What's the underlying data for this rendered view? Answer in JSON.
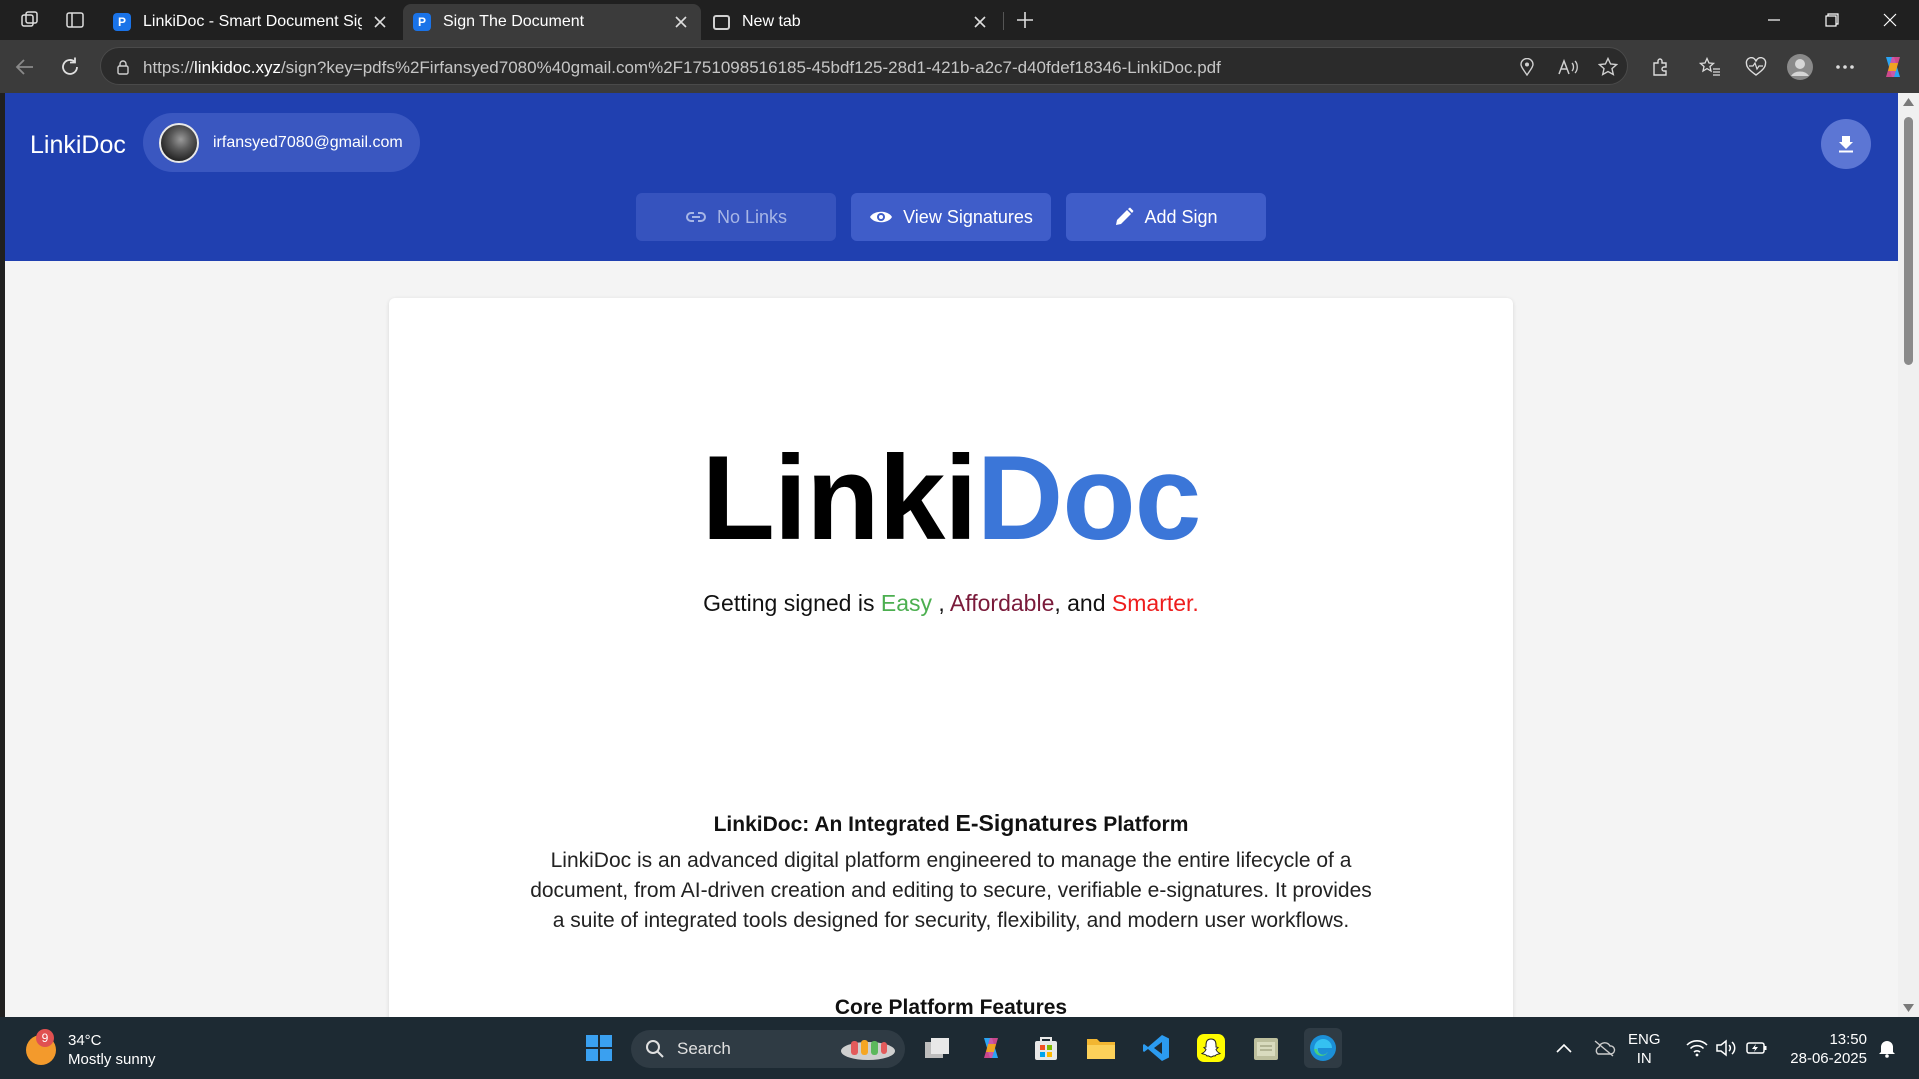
{
  "browser": {
    "tabs": [
      {
        "title": "LinkiDoc - Smart Document Signi",
        "favicon": "linkidoc-favicon",
        "active": false
      },
      {
        "title": "Sign The Document",
        "favicon": "linkidoc-favicon",
        "active": true
      },
      {
        "title": "New tab",
        "favicon": "newtab-icon",
        "active": false
      }
    ],
    "favicon_letter": "P",
    "url_prefix": "https://",
    "url_host": "linkidoc.xyz",
    "url_path": "/sign?key=pdfs%2Firfansyed7080%40gmail.com%2F1751098516185-45bdf125-28d1-421b-a2c7-d40fdef18346-LinkiDoc.pdf"
  },
  "app": {
    "brand": "LinkiDoc",
    "user_email": "irfansyed7080@gmail.com",
    "actions": {
      "no_links": "No Links",
      "view_signatures": "View Signatures",
      "add_sign": "Add Sign"
    },
    "accent_color": "#2040b0"
  },
  "document": {
    "logo_part1": "Linki",
    "logo_part2": "Doc",
    "tagline_prefix": "Getting signed is ",
    "tagline_easy": "Easy",
    "tagline_sep1": " , ",
    "tagline_affordable": "Affordable",
    "tagline_sep2": ", and ",
    "tagline_smarter": "Smarter.",
    "section_title_a": "LinkiDoc: An Integrated ",
    "section_title_b": "E-Signatures",
    "section_title_c": " Platform",
    "paragraph": "LinkiDoc is an advanced digital platform engineered to manage the entire lifecycle of a document, from AI-driven creation and editing to secure, verifiable e-signatures. It provides a suite of integrated tools designed for security, flexibility, and modern user workflows.",
    "section_title_2": "Core Platform Features"
  },
  "taskbar": {
    "temperature": "34°C",
    "weather": "Mostly sunny",
    "weather_badge": "9",
    "search_label": "Search",
    "lang_line1": "ENG",
    "lang_line2": "IN",
    "time": "13:50",
    "date": "28-06-2025"
  }
}
